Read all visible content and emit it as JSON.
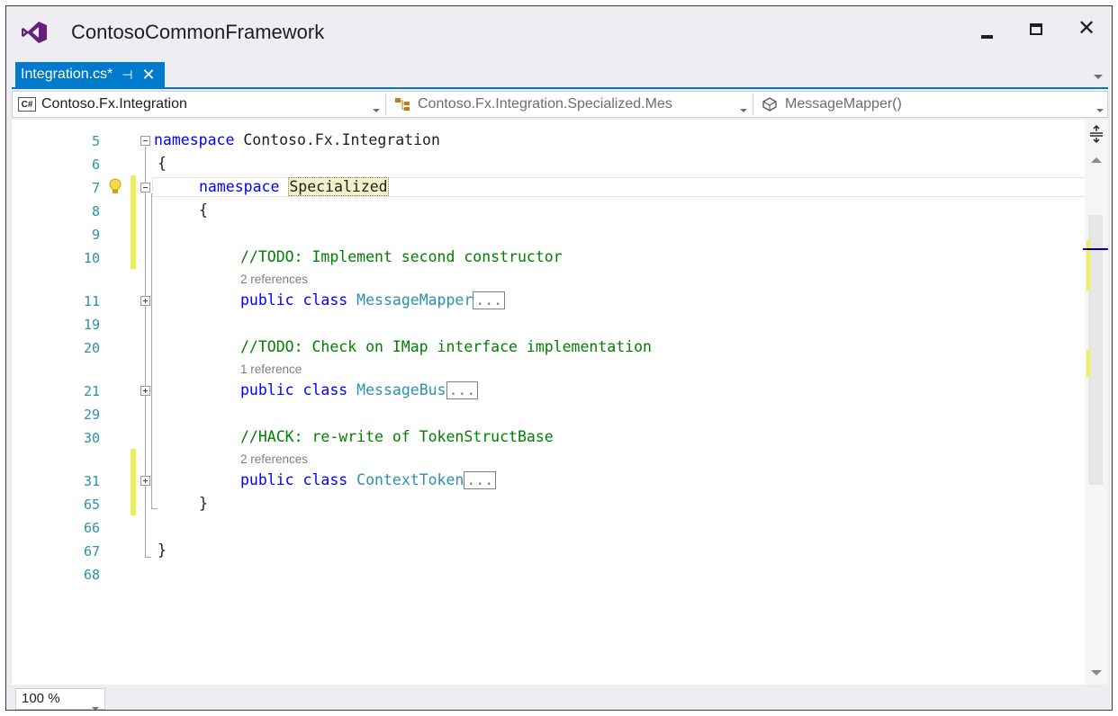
{
  "window": {
    "title": "ContosoCommonFramework",
    "controls": {
      "minimize": "minimize-icon",
      "maximize": "maximize-icon",
      "close": "close-icon"
    }
  },
  "tab": {
    "label": "Integration.cs*",
    "pin_icon": "pin-icon",
    "close_icon": "close-icon"
  },
  "navbar": {
    "project": "Contoso.Fx.Integration",
    "type": "Contoso.Fx.Integration.Specialized.Mes",
    "member": "MessageMapper()"
  },
  "editor": {
    "line_numbers": [
      "5",
      "6",
      "7",
      "8",
      "9",
      "10",
      "11",
      "19",
      "20",
      "21",
      "29",
      "30",
      "31",
      "65",
      "66",
      "67",
      "68"
    ],
    "code": {
      "l5_kw": "namespace",
      "l5_name": " Contoso.Fx.Integration",
      "l6": "{",
      "l7_kw": "namespace",
      "l7_name": "Specialized",
      "l8": "{",
      "l10_comment": "//TODO: Implement second constructor",
      "refs1": "2 references",
      "l11_kw": "public class",
      "l11_name": "MessageMapper",
      "l20_comment": "//TODO: Check on IMap interface implementation",
      "refs2": "1 reference",
      "l21_kw": "public class",
      "l21_name": "MessageBus",
      "l30_comment": "//HACK: re-write of TokenStructBase",
      "refs3": "2 references",
      "l31_kw": "public class",
      "l31_name": "ContextToken",
      "l65": "}",
      "l67": "}",
      "collapsed": "..."
    }
  },
  "zoom": {
    "value": "100 %"
  },
  "colors": {
    "keyword": "#0000ff",
    "class_name": "#2b91af",
    "comment": "#008000",
    "tab_active": "#007acc",
    "change_marker": "#efef55"
  }
}
